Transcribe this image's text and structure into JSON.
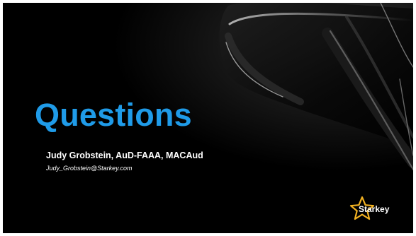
{
  "slide": {
    "title": "Questions",
    "presenter": "Judy Grobstein, AuD-FAAA, MACAud",
    "email": "Judy_Grobstein@Starkey.com",
    "logo": {
      "name": "Starkey",
      "icon": "star-logo-icon"
    }
  },
  "colors": {
    "background": "#000000",
    "title": "#1f9be8",
    "text": "#ffffff",
    "logo_star": "#f2b222"
  }
}
